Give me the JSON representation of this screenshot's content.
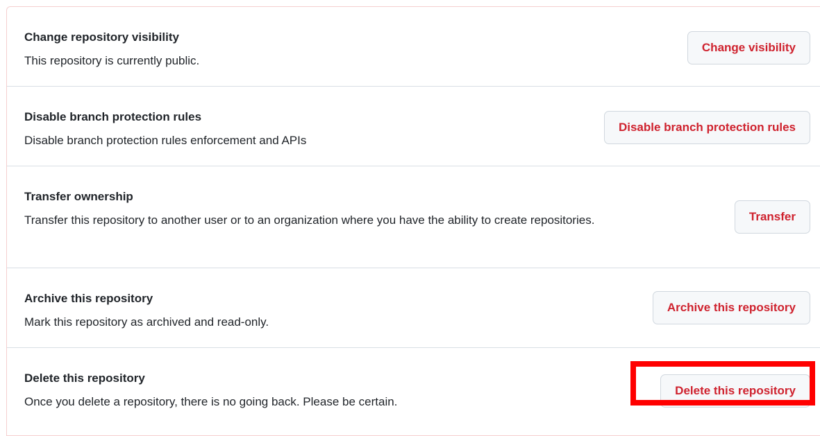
{
  "danger_zone": {
    "items": [
      {
        "title": "Change repository visibility",
        "description": "This repository is currently public.",
        "button_label": "Change visibility"
      },
      {
        "title": "Disable branch protection rules",
        "description": "Disable branch protection rules enforcement and APIs",
        "button_label": "Disable branch protection rules"
      },
      {
        "title": "Transfer ownership",
        "description": "Transfer this repository to another user or to an organization where you have the ability to create repositories.",
        "button_label": "Transfer"
      },
      {
        "title": "Archive this repository",
        "description": "Mark this repository as archived and read-only.",
        "button_label": "Archive this repository"
      },
      {
        "title": "Delete this repository",
        "description": "Once you delete a repository, there is no going back. Please be certain.",
        "button_label": "Delete this repository"
      }
    ]
  },
  "colors": {
    "danger_text": "#cf222e",
    "highlight": "#ff0000",
    "border": "#d8dee4",
    "button_bg": "#f6f8fa"
  }
}
